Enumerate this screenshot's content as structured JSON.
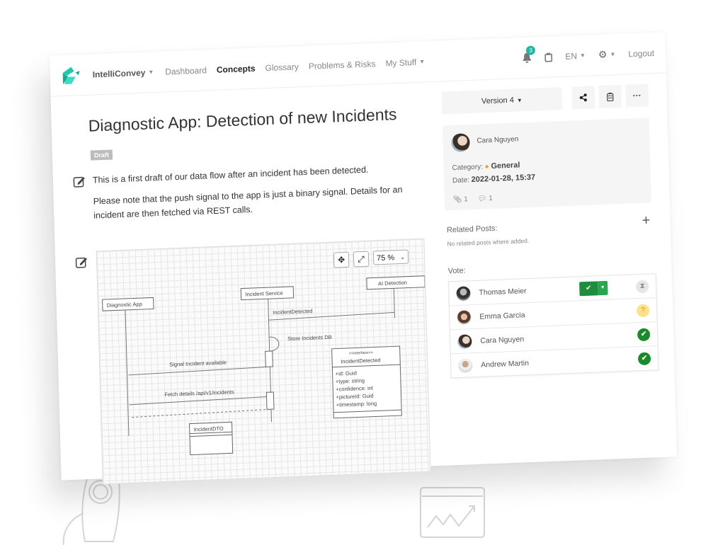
{
  "navbar": {
    "brand": "IntelliConvey",
    "links": [
      {
        "label": "Dashboard",
        "active": false
      },
      {
        "label": "Concepts",
        "active": true
      },
      {
        "label": "Glossary",
        "active": false
      },
      {
        "label": "Problems & Risks",
        "active": false
      },
      {
        "label": "My Stuff",
        "active": false,
        "dropdown": true
      }
    ],
    "notifications_count": "3",
    "language": "EN",
    "logout": "Logout",
    "accent_color": "#1fb8a6"
  },
  "post": {
    "title": "Diagnostic App: Detection of new Incidents",
    "status_badge": "Draft",
    "paragraph1": "This is a first draft of our data flow after an incident has been detected.",
    "paragraph2": "Please note that the push signal to the app is just a binary signal. Details for an incident are then fetched via REST calls."
  },
  "diagram": {
    "zoom_level": "75 %",
    "lifelines": [
      "Diagnostic App",
      "Incident Service",
      "AI Detection"
    ],
    "messages": [
      "IncidentDetected",
      "Store Incidents DB",
      "Signal Incident available",
      "Fetch details /api/v1/incidents"
    ],
    "class_box": {
      "stereotype": "<<interface>>",
      "name": "IncidentDetected",
      "fields": [
        "+id: Guid",
        "+type: string",
        "+confidence: int",
        "+pictureId: Guid",
        "+timestamp: long"
      ]
    },
    "dto_box": "IncidentDTO"
  },
  "sidebar": {
    "version": "Version 4",
    "author": "Cara Nguyen",
    "category_label": "Category:",
    "category_value": "General",
    "date_label": "Date:",
    "date_value": "2022-01-28, 15:37",
    "attachments": "1",
    "comments": "1",
    "related_title": "Related Posts:",
    "related_empty": "No related posts where added.",
    "vote_title": "Vote:",
    "votes": [
      {
        "name": "Thomas Meier",
        "status": "pending"
      },
      {
        "name": "Emma Garcia",
        "status": "unknown"
      },
      {
        "name": "Cara Nguyen",
        "status": "approved"
      },
      {
        "name": "Andrew Martin",
        "status": "approved"
      }
    ]
  }
}
